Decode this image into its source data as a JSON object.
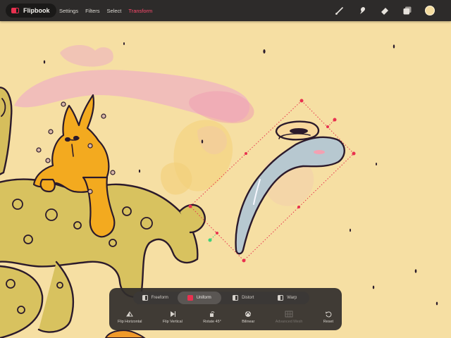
{
  "app": {
    "name": "Flipbook"
  },
  "menu": {
    "items": [
      {
        "label": "Settings",
        "active": false
      },
      {
        "label": "Filters",
        "active": false
      },
      {
        "label": "Select",
        "active": false
      },
      {
        "label": "Transform",
        "active": true
      }
    ]
  },
  "tools": [
    {
      "icon": "brush-icon"
    },
    {
      "icon": "smudge-icon"
    },
    {
      "icon": "eraser-icon"
    },
    {
      "icon": "layers-icon"
    },
    {
      "icon": "color-swatch-icon",
      "color": "#f4dc9f"
    }
  ],
  "transform_panel": {
    "modes": [
      {
        "label": "Freeform",
        "active": false
      },
      {
        "label": "Uniform",
        "active": true
      },
      {
        "label": "Distort",
        "active": false
      },
      {
        "label": "Warp",
        "active": false
      }
    ],
    "actions": [
      {
        "label": "Flip Horizontal",
        "icon": "flip-horizontal-icon",
        "enabled": true
      },
      {
        "label": "Flip Vertical",
        "icon": "flip-vertical-icon",
        "enabled": true
      },
      {
        "label": "Rotate 45°",
        "icon": "rotate-icon",
        "enabled": true
      },
      {
        "label": "Bilinear",
        "icon": "bilinear-icon",
        "enabled": true
      },
      {
        "label": "Advanced Mesh",
        "icon": "mesh-icon",
        "enabled": false
      },
      {
        "label": "Reset",
        "icon": "reset-icon",
        "enabled": true
      }
    ]
  },
  "colors": {
    "accent": "#e8314f",
    "canvas": "#f6dfa3",
    "toolbar": "#2d2b2a"
  }
}
